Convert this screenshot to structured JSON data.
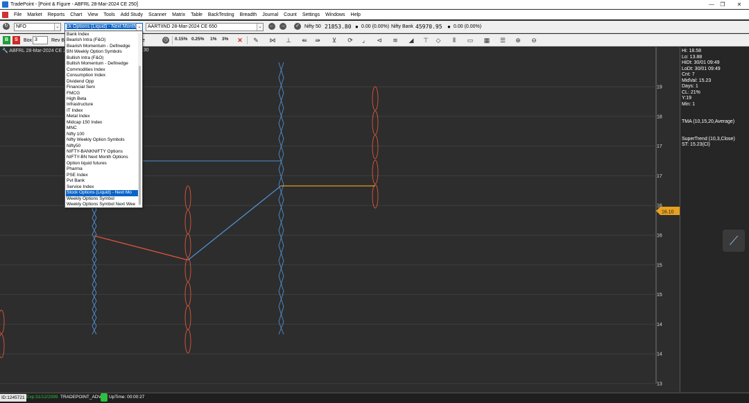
{
  "window": {
    "title": "TradePoint - [Point & Figure - ABFRL 28-Mar-2024 CE 250]",
    "controls": [
      "—",
      "❐",
      "✕"
    ]
  },
  "menu": [
    "File",
    "Market",
    "Reports",
    "Chart",
    "View",
    "Tools",
    "Add Study",
    "Scanner",
    "Matrix",
    "Table",
    "BackTesting",
    "Breadth",
    "Journal",
    "Count",
    "Settings",
    "Windows",
    "Help"
  ],
  "toolbar1": {
    "exchange": "NFO",
    "list_selected": "ck Options (Liquid) - Next Month",
    "symbol": "AARTIIND 28-Mar-2024 CE 650",
    "indices": [
      {
        "name": "Nifty 50",
        "value": "21853.80",
        "change": "0.00 (0.00%)"
      },
      {
        "name": "Nifty Bank",
        "value": "45970.95",
        "change": "0.00 (0.00%)"
      }
    ]
  },
  "toolbar2": {
    "buy": "B",
    "sell": "S",
    "box_label": "Box",
    "box_value": "3",
    "rev_label": "Rev B",
    "date_fragment": "e",
    "pct_buttons": [
      "0.15%",
      "0.25%",
      "1%",
      "3%"
    ]
  },
  "chart": {
    "header": "ABFRL 28-Mar-2024 CE 2",
    "header_time": "15:30",
    "y_labels": [
      "19",
      "18",
      "17",
      "17",
      "16",
      "16",
      "15",
      "15",
      "14",
      "14",
      "13"
    ],
    "current_price": "16.10",
    "colors": {
      "up": "#4f8fd0",
      "down": "#e0553a",
      "tma": "#e0553a",
      "supertrend": "#e0a020",
      "marker": "#e8a020"
    }
  },
  "chart_data": {
    "type": "point-and-figure",
    "columns": [
      {
        "kind": "X",
        "from": 13.8,
        "to": 16.6
      },
      {
        "kind": "O",
        "from": 16.8,
        "to": 13.3
      },
      {
        "kind": "X",
        "from": 13.8,
        "to": 18.8
      },
      {
        "kind": "O",
        "from": 18.6,
        "to": 16.8
      }
    ]
  },
  "info": {
    "lines": [
      "Hi: 18.58",
      "Lo: 13.88",
      "HiDt: 30/01 09:49",
      "LoDt: 30/01 09:49",
      "Cnt: 7",
      "MidVal: 15.23",
      "Days: 1",
      "CL: 21%",
      "Y:19",
      "Min: 1"
    ],
    "tma": "TMA (10,15,20,Average)",
    "supertrend": "SuperTrend (10,3,Close)",
    "st": "ST: 15.23(Cl)"
  },
  "dropdown": {
    "items": [
      "Bank Index",
      "Bearish Intra (F&O)",
      "Bearish Momentum - Definedge",
      "BN Weekly Option Symbols",
      "Bullish Intra (F&O)",
      "Bullish Momentum - Definedge",
      "Commodities Index",
      "Consumption Index",
      "Dividend Opp",
      "Financial Serv",
      "FMCG",
      "High Beta",
      "Infrastructure",
      "IT Index",
      "Metal Index",
      "Midcap 150 Index",
      "MNC",
      "Nifty 100",
      "Nifty Weekly Option Symbols",
      "Nifty50",
      "NIFTY-BANKNIFTY Options",
      "NIFTY-BN Next Month Options",
      "Option liquid futures",
      "Pharma",
      "PSE Index",
      "Pvt Bank",
      "Service Index",
      "Stock Options (Liquid) - Next Mo",
      "Weekly Options Symbol",
      "Weekly Options Symbol Next Wee"
    ],
    "selected_index": 27
  },
  "status": {
    "id": "ID:1245721",
    "exp": "Exp:31/12/2099",
    "user": "TRADEPOINT_ADV",
    "uptime": "UpTime: 00:00:27"
  }
}
